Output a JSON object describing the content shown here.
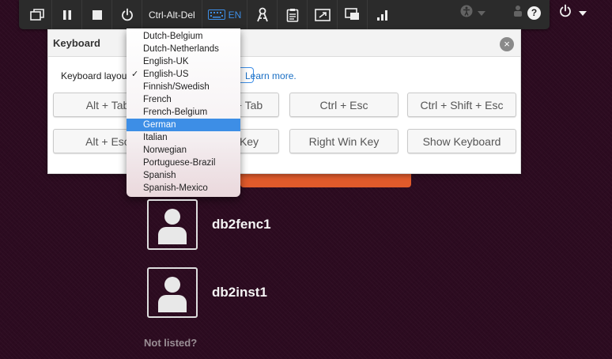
{
  "toolbar": {
    "cad_label": "Ctrl-Alt-Del",
    "lang_label": "EN"
  },
  "keyboard_panel": {
    "title": "Keyboard",
    "layout_label": "Keyboard layou",
    "learn_more": "Learn more.",
    "keys": [
      {
        "label": "Alt + Tab"
      },
      {
        "label": "+ Tab"
      },
      {
        "label": "Ctrl + Esc"
      },
      {
        "label": "Ctrl + Shift + Esc"
      },
      {
        "label": "Alt + Esc"
      },
      {
        "label": "Key"
      },
      {
        "label": "Right Win Key"
      },
      {
        "label": "Show Keyboard"
      }
    ]
  },
  "language_dropdown": {
    "options": [
      "Dutch-Belgium",
      "Dutch-Netherlands",
      "English-UK",
      "English-US",
      "Finnish/Swedish",
      "French",
      "French-Belgium",
      "German",
      "Italian",
      "Norwegian",
      "Portuguese-Brazil",
      "Spanish",
      "Spanish-Mexico"
    ],
    "checked": "English-US",
    "highlighted": "German"
  },
  "login": {
    "users": [
      {
        "name": "db2fenc1"
      },
      {
        "name": "db2inst1"
      }
    ],
    "not_listed": "Not listed?"
  },
  "colors": {
    "accent": "#3d8ee6",
    "orange": "#e05a2b",
    "background": "#2c0b20"
  }
}
